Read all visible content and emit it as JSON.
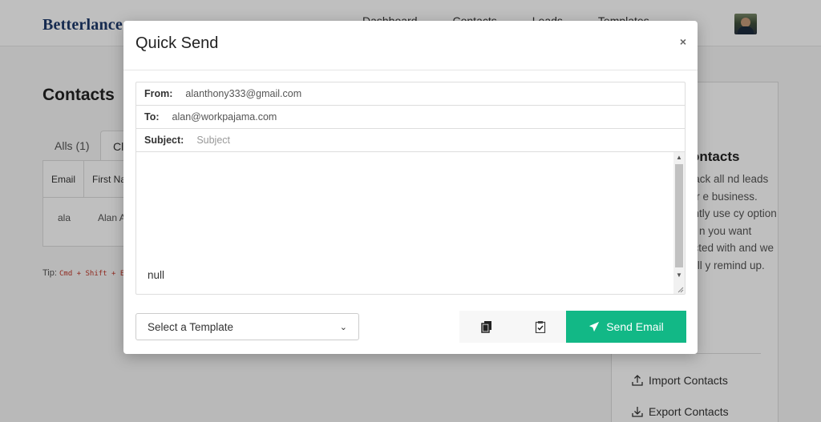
{
  "app": {
    "brand": "Betterlance"
  },
  "nav": [
    "Dashboard",
    "Contacts",
    "Leads",
    "Templates"
  ],
  "contacts_page": {
    "title": "Contacts",
    "tabs": [
      {
        "label": "Alls (1)"
      },
      {
        "label": "Cl"
      }
    ],
    "table": {
      "headers": [
        "Email",
        "First Na"
      ],
      "rows": [
        [
          "ala",
          "Alan A"
        ]
      ]
    },
    "tip_prefix": "Tip:",
    "tip_code": "Cmd + Shift + E"
  },
  "sidebar": {
    "title": "ontacts",
    "text": "track all nd leads for e business. antly use cy option to n you want ected with and we will y remind up.",
    "links": [
      {
        "label": "Import Contacts",
        "icon": "upload-icon"
      },
      {
        "label": "Export Contacts",
        "icon": "download-icon"
      }
    ]
  },
  "modal": {
    "title": "Quick Send",
    "close": "×",
    "from_label": "From:",
    "from_value": "alanthony333@gmail.com",
    "to_label": "To:",
    "to_value": "alan@workpajama.com",
    "subject_label": "Subject:",
    "subject_placeholder": "Subject",
    "body": "null",
    "template_select": "Select a Template",
    "copy_icon": "copy-icon",
    "paste_icon": "clipboard-check-icon",
    "send_label": "Send Email",
    "send_color": "#12b886"
  }
}
